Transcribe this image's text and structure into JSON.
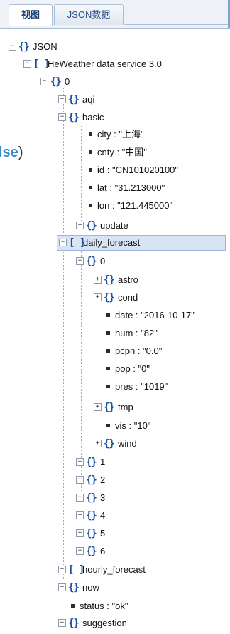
{
  "tabs": [
    {
      "label": "视图"
    },
    {
      "label": "JSON数据"
    }
  ],
  "side_fragment": {
    "text": "lse",
    "paren": ")"
  },
  "tree": {
    "root": "JSON",
    "service": "HeWeather data service 3.0",
    "idx0": "0",
    "aqi": "aqi",
    "basic": "basic",
    "basic_fields": [
      "city : \"上海\"",
      "cnty : \"中国\"",
      "id : \"CN101020100\"",
      "lat : \"31.213000\"",
      "lon : \"121.445000\""
    ],
    "update": "update",
    "daily_forecast": "daily_forecast",
    "df0": "0",
    "astro": "astro",
    "cond": "cond",
    "df0_fields": [
      "date : \"2016-10-17\"",
      "hum : \"82\"",
      "pcpn : \"0.0\"",
      "pop : \"0\"",
      "pres : \"1019\""
    ],
    "tmp": "tmp",
    "vis": "vis : \"10\"",
    "wind": "wind",
    "df_items": [
      "1",
      "2",
      "3",
      "4",
      "5",
      "6"
    ],
    "hourly_forecast": "hourly_forecast",
    "now": "now",
    "status": "status : \"ok\"",
    "suggestion": "suggestion"
  }
}
